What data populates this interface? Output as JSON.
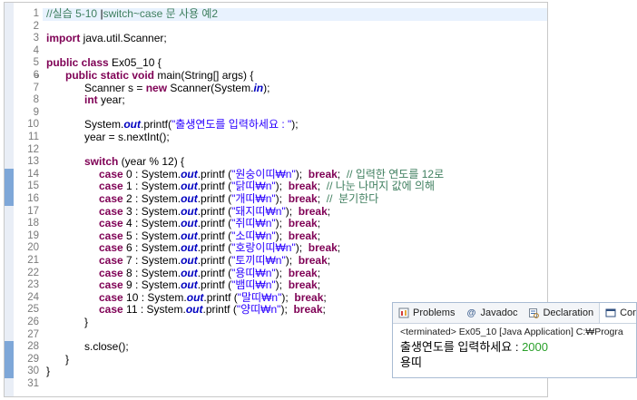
{
  "editor": {
    "line_numbers": [
      "1",
      "2",
      "3",
      "4",
      "5",
      "6",
      "7",
      "8",
      "9",
      "10",
      "11",
      "12",
      "13",
      "14",
      "15",
      "16",
      "17",
      "18",
      "19",
      "20",
      "21",
      "22",
      "23",
      "24",
      "25",
      "26",
      "27",
      "28",
      "29",
      "30",
      "31"
    ],
    "line1_comment": "//실습 5-10",
    "line1_comment_rest": "switch~case 문 사용 예2",
    "line3": [
      "import",
      " java.util.Scanner;"
    ],
    "line5": [
      "public class",
      " Ex05_10 {"
    ],
    "line6": [
      "public static void",
      " main(String[] args) {"
    ],
    "line7": [
      "Scanner s = ",
      "new",
      " Scanner(System.",
      "in",
      ");"
    ],
    "line8": [
      "int",
      " year;"
    ],
    "line10": [
      "System.",
      "out",
      ".printf(",
      "\"출생연도를 입력하세요 : \"",
      ");"
    ],
    "line11": "year = s.nextInt();",
    "line13": [
      "switch",
      " (year % 12) {"
    ],
    "cases": [
      {
        "kw": "case",
        "label": " 0 : System.",
        "fld": "out",
        "call": ".printf (",
        "str": "\"원숭이띠₩n\"",
        "end": ");",
        "brk": "break",
        "tail": ";",
        "comment": "// 입력한 연도를 12로"
      },
      {
        "kw": "case",
        "label": " 1 : System.",
        "fld": "out",
        "call": ".printf (",
        "str": "\"닭띠₩n\"",
        "end": ");",
        "brk": "break",
        "tail": ";",
        "comment": "// 나눈 나머지 값에 의해"
      },
      {
        "kw": "case",
        "label": " 2 : System.",
        "fld": "out",
        "call": ".printf (",
        "str": "\"개띠₩n\"",
        "end": ");",
        "brk": "break",
        "tail": ";",
        "comment": "//  분기한다"
      },
      {
        "kw": "case",
        "label": " 3 : System.",
        "fld": "out",
        "call": ".printf (",
        "str": "\"돼지띠₩n\"",
        "end": ");",
        "brk": "break",
        "tail": ";",
        "comment": ""
      },
      {
        "kw": "case",
        "label": " 4 : System.",
        "fld": "out",
        "call": ".printf (",
        "str": "\"쥐띠₩n\"",
        "end": ");",
        "brk": "break",
        "tail": ";",
        "comment": ""
      },
      {
        "kw": "case",
        "label": " 5 : System.",
        "fld": "out",
        "call": ".printf (",
        "str": "\"소띠₩n\"",
        "end": ");",
        "brk": "break",
        "tail": ";",
        "comment": ""
      },
      {
        "kw": "case",
        "label": " 6 : System.",
        "fld": "out",
        "call": ".printf (",
        "str": "\"호랑이띠₩n\"",
        "end": ");",
        "brk": "break",
        "tail": ";",
        "comment": ""
      },
      {
        "kw": "case",
        "label": " 7 : System.",
        "fld": "out",
        "call": ".printf (",
        "str": "\"토끼띠₩n\"",
        "end": ");",
        "brk": "break",
        "tail": ";",
        "comment": ""
      },
      {
        "kw": "case",
        "label": " 8 : System.",
        "fld": "out",
        "call": ".printf (",
        "str": "\"용띠₩n\"",
        "end": ");",
        "brk": "break",
        "tail": ";",
        "comment": ""
      },
      {
        "kw": "case",
        "label": " 9 : System.",
        "fld": "out",
        "call": ".printf (",
        "str": "\"뱀띠₩n\"",
        "end": ");",
        "brk": "break",
        "tail": ";",
        "comment": ""
      },
      {
        "kw": "case",
        "label": " 10 : System.",
        "fld": "out",
        "call": ".printf (",
        "str": "\"말띠₩n\"",
        "end": ");",
        "brk": "break",
        "tail": ";",
        "comment": ""
      },
      {
        "kw": "case",
        "label": " 11 : System.",
        "fld": "out",
        "call": ".printf (",
        "str": "\"양띠₩n\"",
        "end": ");",
        "brk": "break",
        "tail": ";",
        "comment": ""
      }
    ],
    "line26": "}",
    "line28": "s.close();",
    "line29": "}",
    "line30": "}"
  },
  "console": {
    "tabs": [
      {
        "label": "Problems",
        "icon": "problems-icon"
      },
      {
        "label": "Javadoc",
        "icon": "javadoc-icon"
      },
      {
        "label": "Declaration",
        "icon": "declaration-icon"
      },
      {
        "label": "Con",
        "icon": "console-icon"
      }
    ],
    "status": "<terminated> Ex05_10 [Java Application] C:₩Progra",
    "prompt": "출생연도를 입력하세요 : ",
    "input": "2000",
    "result": "용띠"
  },
  "colors": {
    "keyword": "#7f0055",
    "string": "#2a00ff",
    "comment": "#3f7f5f",
    "field": "#0000c0",
    "console_input": "#2aa02a"
  }
}
